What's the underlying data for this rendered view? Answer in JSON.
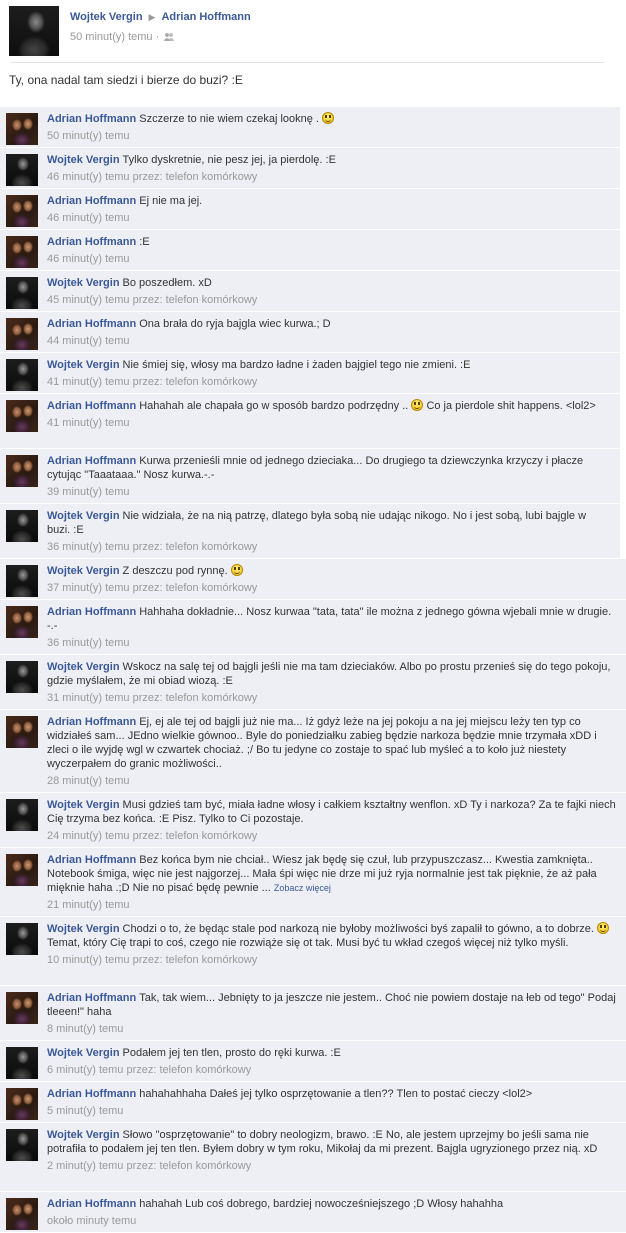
{
  "post": {
    "author": "Wojtek Vergin",
    "arrow": "▶",
    "target": "Adrian Hoffmann",
    "time": "50 minut(y) temu",
    "dot": "·",
    "text": "Ty, ona nadal tam siedzi i bierze do buzi? :E"
  },
  "comments": [
    {
      "author": "Adrian Hoffmann",
      "avatar": "adrian",
      "text": "Szczerze to nie wiem czekaj looknę .",
      "smiley": true,
      "text2": "",
      "time": "50 minut(y) temu",
      "via": ""
    },
    {
      "author": "Wojtek Vergin",
      "avatar": "wojtek",
      "text": "Tylko dyskretnie, nie pesz jej, ja pierdolę. :E",
      "time": "46 minut(y) temu",
      "via": " przez: telefon komórkowy"
    },
    {
      "author": "Adrian Hoffmann",
      "avatar": "adrian",
      "text": "Ej nie ma jej.",
      "time": "46 minut(y) temu",
      "via": ""
    },
    {
      "author": "Adrian Hoffmann",
      "avatar": "adrian",
      "text": ":E",
      "time": "46 minut(y) temu",
      "via": ""
    },
    {
      "author": "Wojtek Vergin",
      "avatar": "wojtek",
      "text": "Bo poszedłem. xD",
      "time": "45 minut(y) temu",
      "via": " przez: telefon komórkowy"
    },
    {
      "author": "Adrian Hoffmann",
      "avatar": "adrian",
      "text": "Ona brała do ryja bajgla wiec kurwa.; D",
      "time": "44 minut(y) temu",
      "via": ""
    },
    {
      "author": "Wojtek Vergin",
      "avatar": "wojtek",
      "text": "Nie śmiej się, włosy ma bardzo ładne i żaden bajgiel tego nie zmieni. :E",
      "time": "41 minut(y) temu",
      "via": " przez: telefon komórkowy"
    },
    {
      "author": "Adrian Hoffmann",
      "avatar": "adrian",
      "text": "Hahahah ale chapała go w sposób bardzo podrzędny ..",
      "smiley": true,
      "text2": "Co ja pierdole shit happens. <lol2>",
      "time": "41 minut(y) temu",
      "via": ""
    },
    {
      "author": "Adrian Hoffmann",
      "avatar": "adrian",
      "text": "Kurwa przenieśli mnie od jednego dzieciaka... Do drugiego ta dziewczynka krzyczy i płacze cytując \"Taaataaa.\" Nosz kurwa.-.-",
      "time": "39 minut(y) temu",
      "via": ""
    },
    {
      "author": "Wojtek Vergin",
      "avatar": "wojtek",
      "text": "Nie widziała, że na nią patrzę, dlatego była sobą nie udając nikogo. No i jest sobą, lubi bajgle w buzi. :E",
      "time": "36 minut(y) temu",
      "via": " przez: telefon komórkowy"
    },
    {
      "author": "Wojtek Vergin",
      "avatar": "wojtek",
      "text": "Z deszczu pod rynnę.",
      "smiley": true,
      "text2": "",
      "time": "37 minut(y) temu",
      "via": " przez: telefon komórkowy"
    },
    {
      "author": "Adrian Hoffmann",
      "avatar": "adrian",
      "text": "Hahhaha dokładnie... Nosz kurwaa \"tata, tata\" ile można z jednego gówna wjebali mnie w drugie. -.-",
      "time": "36 minut(y) temu",
      "via": ""
    },
    {
      "author": "Wojtek Vergin",
      "avatar": "wojtek",
      "text": "Wskocz na salę tej od bajgli jeśli nie ma tam dzieciaków. Albo po prostu przenieś się do tego pokoju, gdzie myślałem, że mi obiad wiozą. :E",
      "time": "31 minut(y) temu",
      "via": " przez: telefon komórkowy"
    },
    {
      "author": "Adrian Hoffmann",
      "avatar": "adrian",
      "text": "Ej, ej ale tej od bajgli już nie ma... Iż gdyż leże na jej pokoju a na jej miejscu leży ten typ co widziałeś sam... JEdno wielkie gównoo.. Byle do poniedziałku zabieg będzie narkoza będzie mnie trzymała xDD i zleci o ile wyjdę wgl w czwartek chociaż. ;/ Bo tu jedyne co zostaje to spać lub myśleć a to koło już niestety wyczerpałem do granic możliwości..",
      "time": "28 minut(y) temu",
      "via": ""
    },
    {
      "author": "Wojtek Vergin",
      "avatar": "wojtek",
      "text": "Musi gdzieś tam być, miała ładne włosy i całkiem kształtny wenflon. xD Ty i narkoza? Za te fajki niech Cię trzyma bez końca. :E Pisz. Tylko to Ci pozostaje.",
      "time": "24 minut(y) temu",
      "via": " przez: telefon komórkowy"
    },
    {
      "author": "Adrian Hoffmann",
      "avatar": "adrian",
      "text": "Bez końca bym nie chciał.. Wiesz jak będę się czuł, lub przypuszczasz... Kwestia zamknięta.. Notebook śmiga, więc nie jest najgorzej... Mała śpi więc nie drze mi już ryja normalnie jest tak pięknie, że aż pała mięknie haha .;D Nie no pisać będę pewnie ...",
      "see_more": "Zobacz więcej",
      "time": "21 minut(y) temu",
      "via": ""
    },
    {
      "author": "Wojtek Vergin",
      "avatar": "wojtek",
      "text": "Chodzi o to, że będąc stale pod narkozą nie byłoby możliwości byś zapalił to gówno, a to dobrze.",
      "smiley": true,
      "text2": "Temat, który Cię trapi to coś, czego nie rozwiąże się ot tak. Musi być tu wkład czegoś więcej niż tylko myśli.",
      "time": "10 minut(y) temu",
      "via": " przez: telefon komórkowy"
    },
    {
      "author": "Adrian Hoffmann",
      "avatar": "adrian",
      "text": "Tak, tak wiem... Jebnięty to ja jeszcze nie jestem.. Choć nie powiem dostaje na łeb od tego\" Podaj tleeen!\" haha",
      "time": "8 minut(y) temu",
      "via": ""
    },
    {
      "author": "Wojtek Vergin",
      "avatar": "wojtek",
      "text": "Podałem jej ten tlen, prosto do ręki kurwa. :E",
      "time": "6 minut(y) temu",
      "via": " przez: telefon komórkowy"
    },
    {
      "author": "Adrian Hoffmann",
      "avatar": "adrian",
      "text": "hahahahhaha Dałeś jej tylko osprzętowanie a tlen?? Tlen to postać cieczy <lol2>",
      "time": "5 minut(y) temu",
      "via": ""
    },
    {
      "author": "Wojtek Vergin",
      "avatar": "wojtek",
      "text": "Słowo \"osprzętowanie\" to dobry neologizm, brawo. :E No, ale jestem uprzejmy bo jeśli sama nie potrafiła to podałem jej ten tlen. Byłem dobry w tym roku, Mikołaj da mi prezent. Bajgla ugryzionego przez nią. xD",
      "time": "2 minut(y) temu",
      "via": " przez: telefon komórkowy"
    },
    {
      "author": "Adrian Hoffmann",
      "avatar": "adrian",
      "text": "hahahah Lub coś dobrego, bardziej nowocześniejszego ;D Włosy hahahha",
      "time": "około minuty temu",
      "via": ""
    }
  ]
}
